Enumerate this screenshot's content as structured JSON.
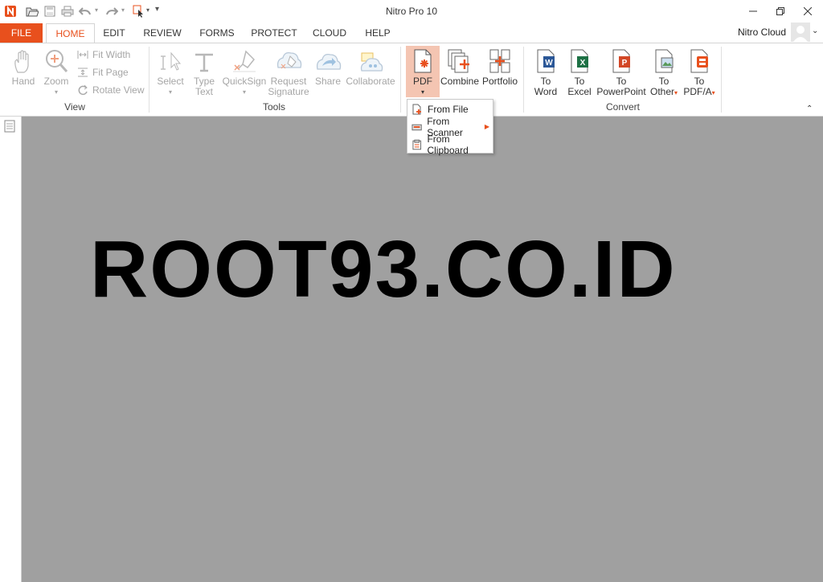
{
  "window": {
    "title": "Nitro Pro 10",
    "minimize_icon": "minimize-icon",
    "restore_icon": "restore-icon",
    "close_icon": "close-icon"
  },
  "quick_access": [
    "app-logo-icon",
    "open-icon",
    "save-icon",
    "print-icon",
    "undo-icon",
    "redo-icon",
    "select-tool-icon",
    "customize-icon"
  ],
  "tabs": {
    "file": "FILE",
    "items": [
      "HOME",
      "EDIT",
      "REVIEW",
      "FORMS",
      "PROTECT",
      "CLOUD",
      "HELP"
    ],
    "active": "HOME"
  },
  "account": {
    "label": "Nitro Cloud"
  },
  "ribbon": {
    "view": {
      "label": "View",
      "hand": "Hand",
      "zoom": "Zoom",
      "fit_width": "Fit Width",
      "fit_page": "Fit Page",
      "rotate_view": "Rotate View"
    },
    "tools": {
      "label": "Tools",
      "select": "Select",
      "type_text_1": "Type",
      "type_text_2": "Text",
      "quicksign": "QuickSign",
      "request_sig_1": "Request",
      "request_sig_2": "Signature",
      "share": "Share",
      "collaborate": "Collaborate"
    },
    "create": {
      "pdf": "PDF",
      "combine": "Combine",
      "portfolio": "Portfolio"
    },
    "convert": {
      "label": "Convert",
      "to_word_1": "To",
      "to_word_2": "Word",
      "to_excel_1": "To",
      "to_excel_2": "Excel",
      "to_ppt_1": "To",
      "to_ppt_2": "PowerPoint",
      "to_other_1": "To",
      "to_other_2": "Other",
      "to_pdfa_1": "To",
      "to_pdfa_2": "PDF/A"
    }
  },
  "pdf_menu": {
    "items": [
      "From File",
      "From Scanner",
      "From Clipboard"
    ]
  },
  "document": {
    "text": "ROOT93.CO.ID"
  },
  "colors": {
    "accent": "#e8501d",
    "workspace": "#a0a0a0",
    "pdf_active": "#f4c5b2"
  }
}
